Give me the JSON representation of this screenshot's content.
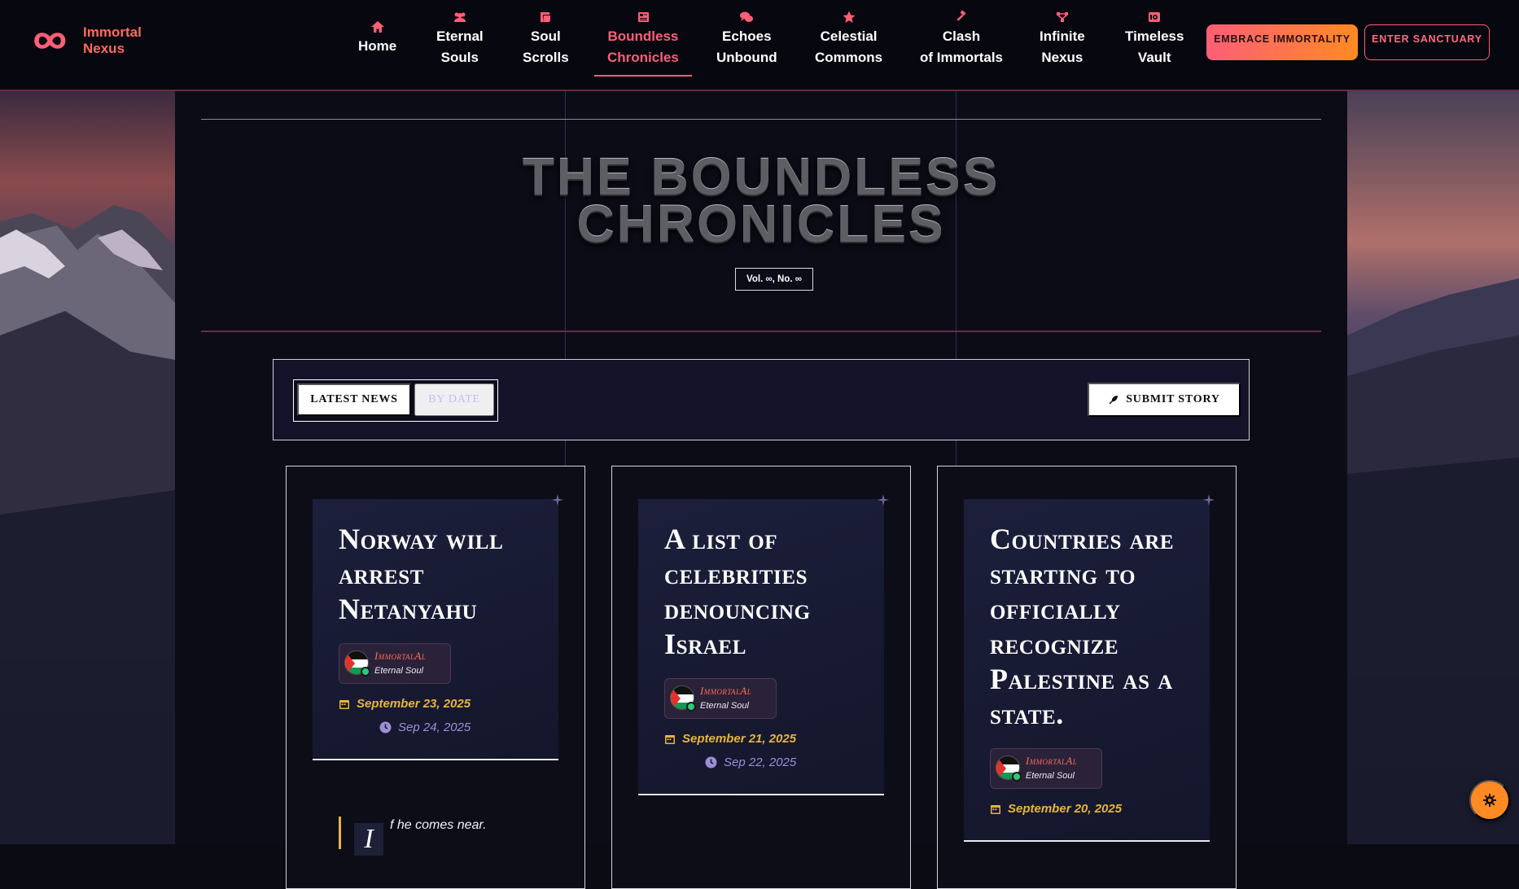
{
  "brand": {
    "line1": "Immortal",
    "line2": "Nexus"
  },
  "nav": [
    {
      "id": "home",
      "line1": "Home",
      "line2": "",
      "icon": "home-icon"
    },
    {
      "id": "eternal-souls",
      "line1": "Eternal",
      "line2": "Souls",
      "icon": "users-icon"
    },
    {
      "id": "soul-scrolls",
      "line1": "Soul",
      "line2": "Scrolls",
      "icon": "scroll-icon"
    },
    {
      "id": "boundless-chronicles",
      "line1": "Boundless",
      "line2": "Chronicles",
      "icon": "newspaper-icon",
      "active": true
    },
    {
      "id": "echoes-unbound",
      "line1": "Echoes",
      "line2": "Unbound",
      "icon": "comments-icon"
    },
    {
      "id": "celestial-commons",
      "line1": "Celestial",
      "line2": "Commons",
      "icon": "star-icon"
    },
    {
      "id": "clash-of-immortals",
      "line1": "Clash",
      "line2": "of Immortals",
      "icon": "gavel-icon"
    },
    {
      "id": "infinite-nexus",
      "line1": "Infinite",
      "line2": "Nexus",
      "icon": "network-icon"
    },
    {
      "id": "timeless-vault",
      "line1": "Timeless",
      "line2": "Vault",
      "icon": "vault-icon"
    }
  ],
  "actions": {
    "embrace": "EMBRACE IMMORTALITY",
    "enter": "ENTER SANCTUARY"
  },
  "page": {
    "title_line1": "THE BOUNDLESS",
    "title_line2": "CHRONICLES",
    "volume": "Vol. ∞, No. ∞"
  },
  "filters": {
    "latest": "LATEST NEWS",
    "by_date": "BY DATE",
    "submit": "SUBMIT STORY"
  },
  "cards": [
    {
      "title": "Norway will arrest Netanyahu",
      "author": "ImmortalAl",
      "role": "Eternal Soul",
      "date": "September 23, 2025",
      "updated": "Sep 24, 2025",
      "excerpt_cap": "I",
      "excerpt": "f he comes near."
    },
    {
      "title": "A list of celebrities denouncing Israel",
      "author": "ImmortalAl",
      "role": "Eternal Soul",
      "date": "September 21, 2025",
      "updated": "Sep 22, 2025"
    },
    {
      "title": "Countries are starting to officially recognize Palestine as a state.",
      "author": "ImmortalAl",
      "role": "Eternal Soul",
      "date": "September 20, 2025"
    }
  ],
  "colors": {
    "accent": "#ff5e77",
    "orange": "#ff8a23",
    "gold": "#e8b53a",
    "panel": "#0c0c17"
  }
}
